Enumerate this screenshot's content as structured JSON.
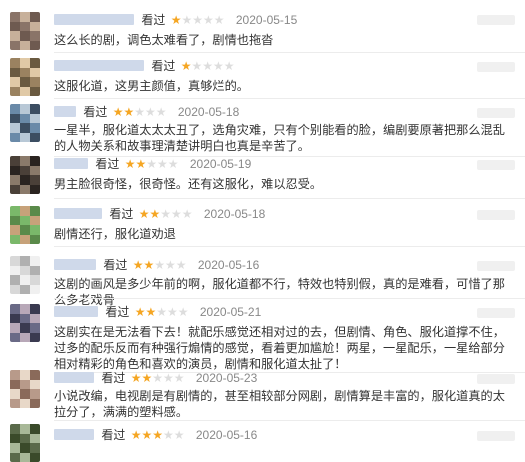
{
  "colors": {
    "star_on": "#f5a623",
    "star_off": "#dddddd",
    "username_blur": "#cfd9ea"
  },
  "reviews": [
    {
      "status": "看过",
      "rating": 1,
      "date": "2020-05-15",
      "comment": "这么长的剧，调色太难看了，剧情也拖沓",
      "avatar_colors": [
        "#8a7468",
        "#c7b09a",
        "#6e5a50"
      ]
    },
    {
      "status": "看过",
      "rating": 1,
      "date": "2020-05-15",
      "comment": "这服化道，这男主颜值，真够烂的。",
      "avatar_colors": [
        "#9a8260",
        "#e0c9a6",
        "#6a5a40"
      ]
    },
    {
      "status": "看过",
      "rating": 2,
      "date": "2020-05-18",
      "comment": "一星半，服化道太太太丑了，选角灾难，只有个别能看的脸，编剧要原著把那么混乱的人物关系和故事理清楚讲明白也真是辛苦了。",
      "avatar_colors": [
        "#6a8aa8",
        "#b8c8d6",
        "#3c4e62"
      ]
    },
    {
      "status": "看过",
      "rating": 2,
      "date": "2020-05-19",
      "comment": "男主脸很奇怪，很奇怪。还有这服化，难以忍受。",
      "avatar_colors": [
        "#4a4038",
        "#8a7a6a",
        "#2a2420"
      ]
    },
    {
      "status": "看过",
      "rating": 2,
      "date": "2020-05-18",
      "comment": "剧情还行，服化道劝退",
      "avatar_colors": [
        "#7ab86a",
        "#c7a27a",
        "#5a8a4a"
      ]
    },
    {
      "status": "看过",
      "rating": 2,
      "date": "2020-05-16",
      "comment": "这剧的画风是多少年前的啊，服化道都不行，特效也特别假，真的是难看，可惜了那么多老戏骨",
      "avatar_colors": [
        "#d8d8d8",
        "#b0b0b0",
        "#f0f0f0"
      ]
    },
    {
      "status": "看过",
      "rating": 2,
      "date": "2020-05-21",
      "comment": "这剧实在是无法看下去！就配乐感觉还相对过的去，但剧情、角色、服化道撑不住，过多的配乐反而有种强行煽情的感觉，看着更加尴尬！两星，一星配乐，一星给部分相对精彩的角色和喜欢的演员，剧情和服化道太扯了！",
      "avatar_colors": [
        "#6a6a86",
        "#b8a8b8",
        "#3a3a50"
      ]
    },
    {
      "status": "看过",
      "rating": 2,
      "date": "2020-05-23",
      "comment": "小说改编，电视剧是有剧情的，甚至相较部分网剧，剧情算是丰富的，服化道真的太拉分了，满满的塑料感。",
      "avatar_colors": [
        "#b89a8a",
        "#e8d8c8",
        "#8a6a5a"
      ]
    },
    {
      "status": "看过",
      "rating": 3,
      "date": "2020-05-16",
      "comment": "",
      "avatar_colors": [
        "#5a6a4a",
        "#a8b898",
        "#3a4a2a"
      ]
    }
  ]
}
